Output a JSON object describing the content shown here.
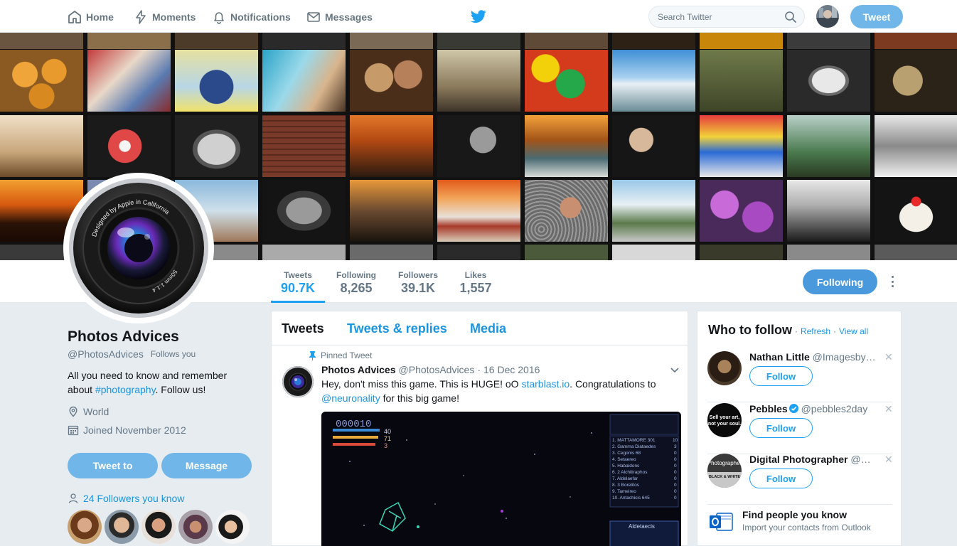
{
  "nav": {
    "home": "Home",
    "moments": "Moments",
    "notifications": "Notifications",
    "messages": "Messages",
    "search_placeholder": "Search Twitter",
    "tweet_button": "Tweet"
  },
  "colors": {
    "accent": "#1da1f2",
    "button_light": "#71b6e8",
    "link": "#1b95e0",
    "muted": "#657786",
    "background": "#e6ecf0"
  },
  "profile_nav": {
    "stats": [
      {
        "label": "Tweets",
        "value": "90.7K",
        "active": true
      },
      {
        "label": "Following",
        "value": "8,265"
      },
      {
        "label": "Followers",
        "value": "39.1K"
      },
      {
        "label": "Likes",
        "value": "1,557"
      }
    ],
    "following_button": "Following"
  },
  "profile": {
    "name": "Photos Advices",
    "handle": "@PhotosAdvices",
    "follows_you": "Follows you",
    "bio_prefix": "All you need to know and remember about ",
    "bio_hashtag": "#photography",
    "bio_suffix": ". Follow us!",
    "location": "World",
    "joined": "Joined November 2012",
    "tweet_to_button": "Tweet to",
    "message_button": "Message",
    "followers_you_know": "24 Followers you know",
    "avatar_lens_text_1": "Designed by Apple in California",
    "avatar_lens_text_2": "50mm 1:1.4"
  },
  "timeline": {
    "tabs": [
      "Tweets",
      "Tweets & replies",
      "Media"
    ],
    "pinned_label": "Pinned Tweet",
    "tweet": {
      "name": "Photos Advices",
      "handle": "@PhotosAdvices",
      "separator": "·",
      "date": "16 Dec 2016",
      "text_1": "Hey, don't miss this game. This is HUGE! oO ",
      "link": "starblast.io",
      "text_2": ". Congratulations to ",
      "mention": "@neuronality",
      "text_3": " for this big game!"
    },
    "game": {
      "score": "000010",
      "stats": [
        "40",
        "71",
        "3"
      ],
      "leaderboard": [
        {
          "name": "1. MATTAMORE 301",
          "score": "10"
        },
        {
          "name": "2. Gamma Diataedes",
          "score": "3"
        },
        {
          "name": "3. Cegonis 68",
          "score": "0"
        },
        {
          "name": "4. Setaereo",
          "score": "0"
        },
        {
          "name": "5. Habaldons",
          "score": "0"
        },
        {
          "name": "6. 2 Alchitiraphos",
          "score": "0"
        },
        {
          "name": "7. Aldelaefar",
          "score": "0"
        },
        {
          "name": "8. 3 Borelitos",
          "score": "0"
        },
        {
          "name": "9. Tameireo",
          "score": "0"
        },
        {
          "name": "10. Antachicis 645",
          "score": "0"
        }
      ],
      "panel_name": "Aldetaecis"
    }
  },
  "who_to_follow": {
    "title": "Who to follow",
    "separator": "·",
    "refresh": "Refresh",
    "view_all": "View all",
    "follow_label": "Follow",
    "suggestions": [
      {
        "name": "Nathan Little",
        "handle": "@Imagesbynath",
        "verified": false
      },
      {
        "name": "Pebbles",
        "handle": "@pebbles2day",
        "verified": true,
        "avatar_text": "Sell your art, not your soul."
      },
      {
        "name": "Digital Photographer",
        "handle": "@DigitalPhotoMag",
        "verified": false,
        "avatar_text": "Photographer BLACK & WHITE"
      }
    ],
    "find_people_title": "Find people you know",
    "find_people_sub": "Import your contacts from Outlook"
  }
}
